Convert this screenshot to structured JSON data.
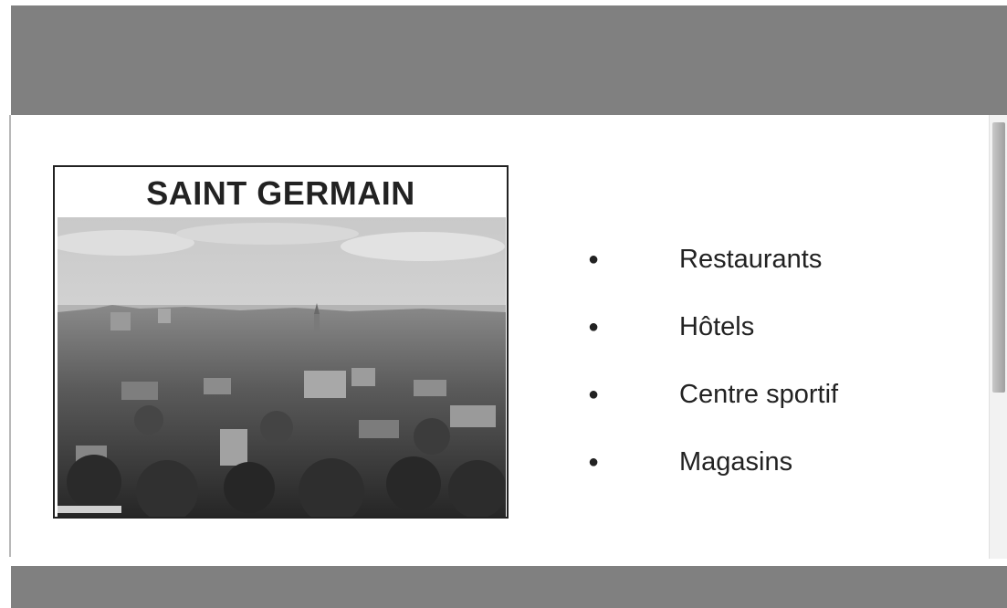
{
  "header": {
    "background_color": "#808080"
  },
  "card": {
    "title": "SAINT GERMAIN",
    "photo_icon": "city-panorama-image"
  },
  "features": [
    {
      "bullet": "●",
      "label": "Restaurants"
    },
    {
      "bullet": "●",
      "label": "Hôtels"
    },
    {
      "bullet": "●",
      "label": "Centre sportif"
    },
    {
      "bullet": "●",
      "label": "Magasins"
    }
  ],
  "footer": {
    "background_color": "#808080"
  }
}
